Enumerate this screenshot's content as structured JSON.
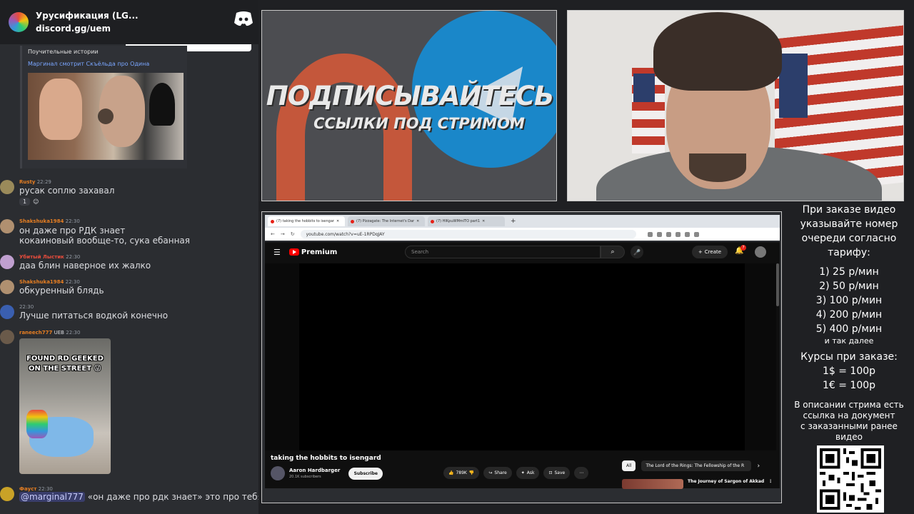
{
  "discord": {
    "server_name": "Урусификация (LG...",
    "invite": "discord.gg/uem"
  },
  "chat": {
    "embed": {
      "channel": "Поучительные истории",
      "title": "Маргинал смотрит Скъёльда про Одина"
    },
    "messages": [
      {
        "user": "Rusty",
        "color": "#e67e22",
        "time": "22:29",
        "text": "русак соплю захавал",
        "reaction_count": "1"
      },
      {
        "user": "Shakshuka1984",
        "color": "#e67e22",
        "time": "22:30",
        "text": "он даже про РДК знает",
        "text2": "кокаиновый вообще-то, сука ебанная"
      },
      {
        "user": "Убитый Лыстик",
        "color": "#e74c3c",
        "time": "22:30",
        "text": "даа блин наверное их жалко"
      },
      {
        "user": "Shakshuka1984",
        "color": "#e67e22",
        "time": "22:30",
        "text": "обкуренный блядь"
      },
      {
        "user": "",
        "color": "#a78bfa",
        "time": "22:30",
        "text": "Лучше питаться водкой конечно"
      },
      {
        "user": "raneech777",
        "color": "#e67e22",
        "badge": "UEB",
        "time": "22:30",
        "meme_caption_1": "FOUND RD GEEKED",
        "meme_caption_2": "ON THE STREET 😜"
      },
      {
        "user": "Фауст",
        "color": "#e67e22",
        "time": "22:30",
        "mention": "@marginal777",
        "text": "«он даже про рдк знает» это про тебя"
      }
    ]
  },
  "banner": {
    "line1": "ПОДПИСЫВАЙТЕСЬ",
    "line2": "ССЫЛКИ ПОД СТРИМОМ"
  },
  "browser": {
    "tabs": [
      {
        "label": "(7) taking the hobbits to isengar",
        "active": true
      },
      {
        "label": "(7) Pizzagate: The Internet's Dar",
        "active": false
      },
      {
        "label": "(7) HIKpuWMmlTO part1",
        "active": false
      }
    ],
    "url": "youtube.com/watch?v=uE-1RPDqJAY",
    "youtube": {
      "brand": "Premium",
      "search_placeholder": "Search",
      "create_label": "Create",
      "notifications": "7",
      "video_title": "taking the hobbits to isengard",
      "channel": "Aaron Hardbarger",
      "subscribers": "20.1K subscribers",
      "subscribe_label": "Subscribe",
      "likes": "789K",
      "share_label": "Share",
      "ask_label": "Ask",
      "save_label": "Save",
      "chip_all": "All",
      "chip_1": "The Lord of the Rings: The Fellowship of the R",
      "rec_title": "The Journey of Sargon of Akkad"
    }
  },
  "info": {
    "lines_top": [
      "При заказе видео",
      "указывайте номер",
      "очереди согласно",
      "тарифу:"
    ],
    "tariffs": [
      "1) 25 р/мин",
      "2) 50 р/мин",
      "3) 100 р/мин",
      "4) 200 р/мин",
      "5) 400 р/мин"
    ],
    "etc": "и так далее",
    "rates_title": "Курсы при заказе:",
    "rates": [
      "1$ = 100р",
      "1€ = 100р"
    ],
    "footer": [
      "В описании стрима есть",
      "ссылка на документ",
      "с заказанными ранее",
      "видео"
    ]
  },
  "colors": {
    "youtube_red": "#ff0000",
    "discord_blurple": "#5865f2",
    "telegram_blue": "#1a87c9",
    "patreon_red": "#c4573b"
  }
}
